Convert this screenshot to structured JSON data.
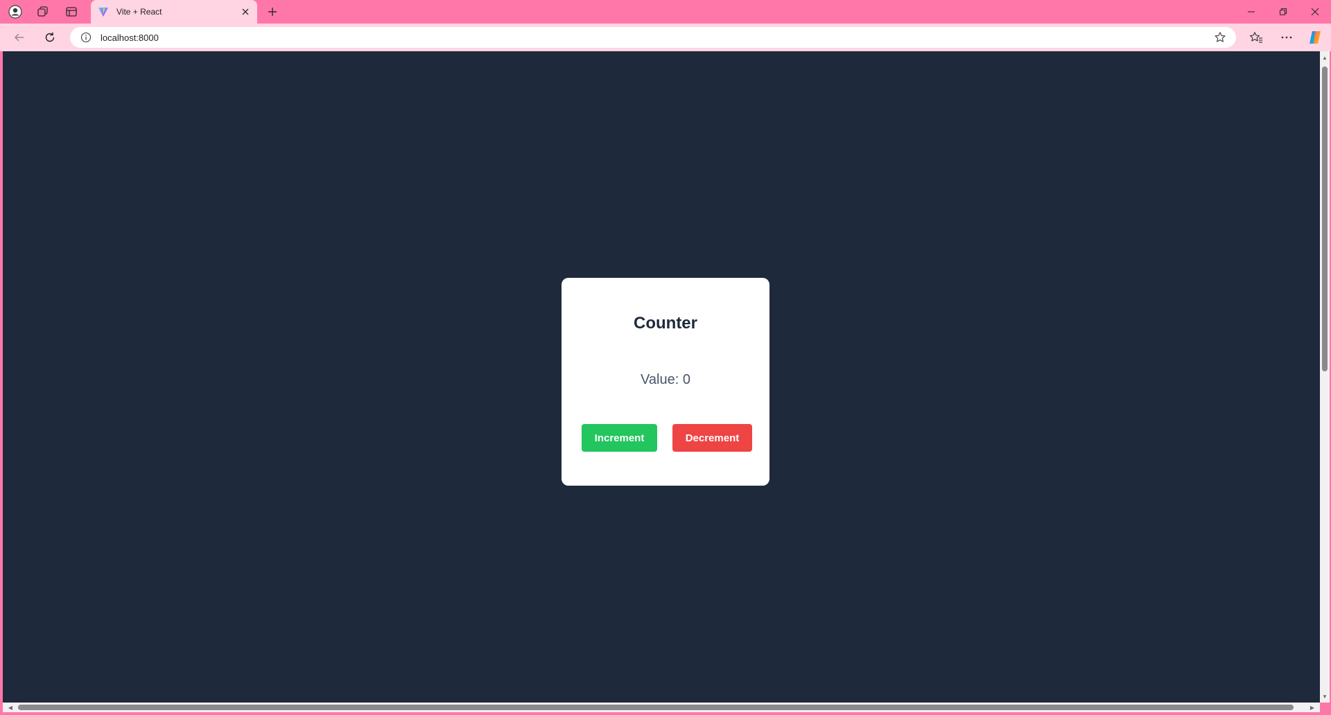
{
  "browser": {
    "tab": {
      "title": "Vite + React"
    },
    "address": {
      "url": "localhost:8000"
    }
  },
  "app": {
    "title": "Counter",
    "value_text": "Value: 0",
    "increment_label": "Increment",
    "decrement_label": "Decrement"
  },
  "icons": {
    "profile": "profile-icon",
    "workspaces": "workspaces-icon",
    "tab_actions": "tab-actions-icon",
    "favicon": "vite-logo-icon",
    "close_tab": "close-icon",
    "new_tab": "plus-icon",
    "minimize": "minimize-icon",
    "restore": "restore-icon",
    "close_window": "close-icon",
    "back": "back-arrow-icon",
    "refresh": "refresh-icon",
    "site_info": "info-icon",
    "favorite": "star-icon",
    "favorites": "favorites-icon",
    "menu": "more-icon",
    "copilot": "copilot-icon"
  },
  "colors": {
    "browser_frame": "#ff77a8",
    "toolbar": "#ffd4e3",
    "page_background": "#1e293b",
    "card": "#ffffff",
    "increment": "#22c55e",
    "decrement": "#ef4444"
  }
}
